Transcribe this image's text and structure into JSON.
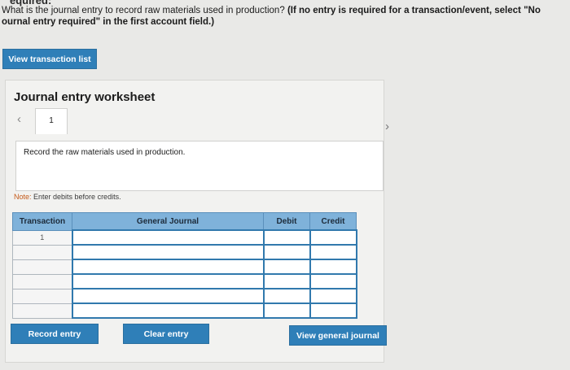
{
  "header": {
    "cut_title": "equired:",
    "question_text": "What is the journal entry to record raw materials used in production?",
    "question_bold": "(If no entry is required for a transaction/event, select \"No",
    "question_line2_bold": "ournal entry required\" in the first account field.)"
  },
  "buttons": {
    "view_transaction_list": "View transaction list",
    "record_entry": "Record entry",
    "clear_entry": "Clear entry",
    "view_general_journal": "View general journal"
  },
  "worksheet": {
    "title": "Journal entry worksheet",
    "prev_icon": "chevron-left-icon",
    "next_icon": "chevron-right-icon",
    "tab_number": "1",
    "instruction": "Record the raw materials used in production.",
    "note_label": "Note:",
    "note_text": " Enter debits before credits."
  },
  "table": {
    "headers": [
      "Transaction",
      "General Journal",
      "Debit",
      "Credit"
    ],
    "rows": [
      {
        "transaction": "1"
      },
      {
        "transaction": ""
      },
      {
        "transaction": ""
      },
      {
        "transaction": ""
      },
      {
        "transaction": ""
      },
      {
        "transaction": ""
      }
    ]
  },
  "colors": {
    "button_blue": "#2f7fb8",
    "table_header_blue": "#7fb2da",
    "input_border_blue": "#3179ad",
    "note_orange": "#c45a1a"
  }
}
